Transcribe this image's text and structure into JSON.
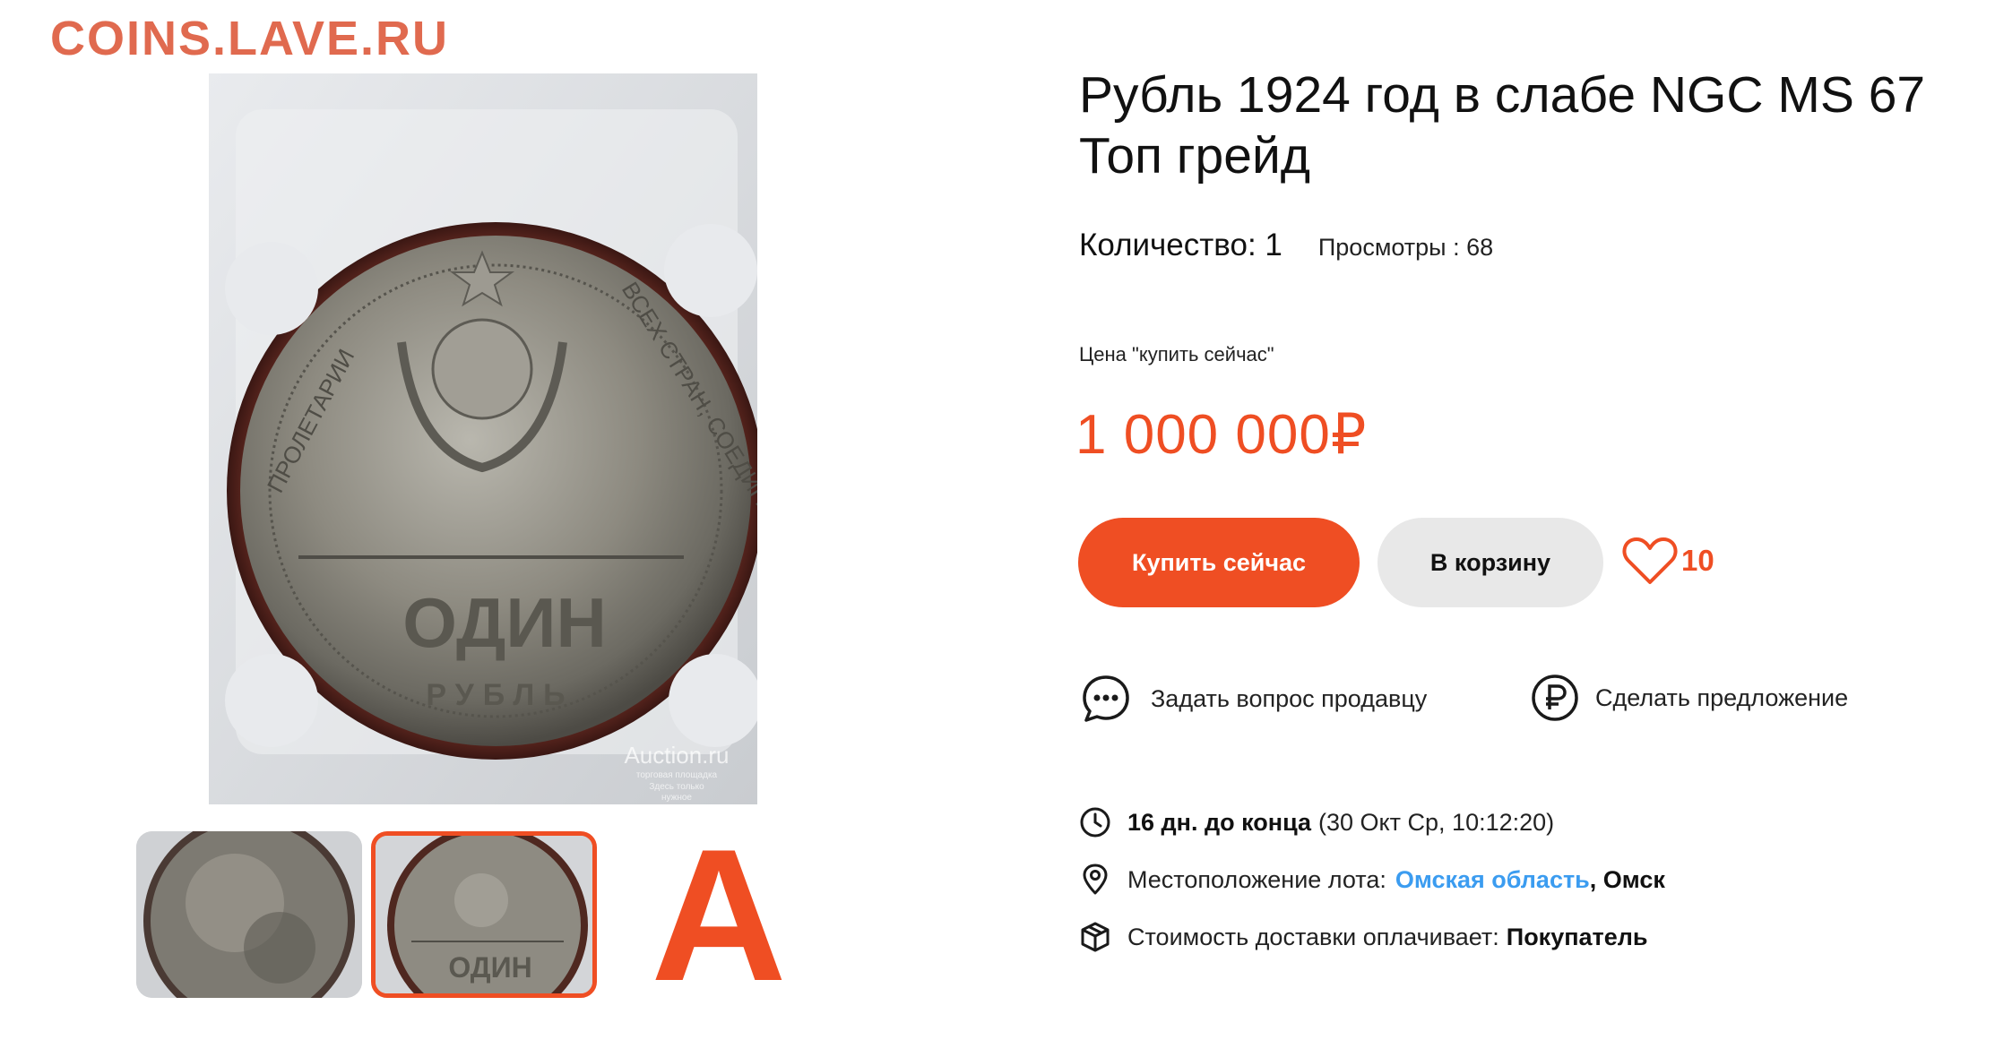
{
  "watermark": "COINS.LAVE.RU",
  "photo": {
    "coin_text_main": "ОДИН",
    "coin_text_sub": "РУБЛЬ",
    "coin_rim_left": "ПРОЛЕТАРИИ",
    "coin_rim_right": "ВСЕХ СТРАН, СОЕДИНЯЙТЕСЬ",
    "photo_watermark": "Auction.ru",
    "photo_watermark_sub1": "торговая площадка",
    "photo_watermark_sub2": "Здесь только",
    "photo_watermark_sub3": "нужное"
  },
  "thumbnails": {
    "third_letter": "A"
  },
  "lot": {
    "title": "Рубль 1924 год в слабе NGC MS 67 Топ грейд",
    "quantity": "Количество: 1",
    "views": "Просмотры : 68",
    "price_label": "Цена \"купить сейчас\"",
    "price": "1 000 000₽"
  },
  "buttons": {
    "buy_now": "Купить сейчас",
    "to_cart": "В корзину",
    "favorites_count": "10"
  },
  "actions": {
    "ask_seller": "Задать вопрос продавцу",
    "make_offer": "Сделать предложение"
  },
  "info": {
    "time_left": "16 дн. до конца",
    "end_date": "(30 Окт Ср, 10:12:20)",
    "location_label": "Местоположение лота:",
    "location_region": "Омская область",
    "location_city": ", Омск",
    "shipping_label": "Стоимость доставки оплачивает:",
    "shipping_payer": "Покупатель"
  },
  "colors": {
    "accent": "#ef4e23",
    "link": "#3b9cf0",
    "watermark": "#e06a4f",
    "secondary_button": "#e8e8e8"
  }
}
